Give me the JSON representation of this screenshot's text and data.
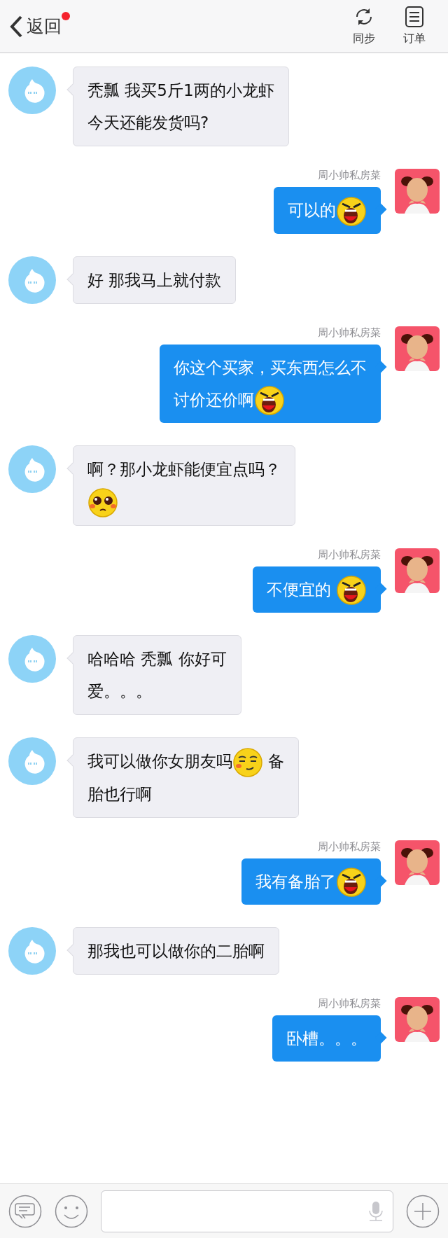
{
  "header": {
    "back_label": "返回",
    "notification_dot": true,
    "actions": [
      {
        "kind": "sync",
        "label": "同步"
      },
      {
        "kind": "orders",
        "label": "订单"
      }
    ]
  },
  "messages": [
    {
      "kind": "incoming",
      "parts": [
        {
          "kind": "text",
          "text": "秃瓢 我买5斤1两的小龙虾"
        },
        {
          "kind": "break"
        },
        {
          "kind": "text",
          "text": "今天还能发货吗?"
        }
      ]
    },
    {
      "kind": "outgoing",
      "sender": "周小帅私房菜",
      "parts": [
        {
          "kind": "text",
          "text": "可以的"
        },
        {
          "kind": "shouting_emoji"
        }
      ]
    },
    {
      "kind": "incoming",
      "parts": [
        {
          "kind": "text",
          "text": "好 那我马上就付款"
        }
      ]
    },
    {
      "kind": "outgoing",
      "sender": "周小帅私房菜",
      "parts": [
        {
          "kind": "text",
          "text": "你这个买家，买东西怎么不"
        },
        {
          "kind": "break"
        },
        {
          "kind": "text",
          "text": "讨价还价啊"
        },
        {
          "kind": "shouting_emoji"
        }
      ]
    },
    {
      "kind": "incoming",
      "parts": [
        {
          "kind": "text",
          "text": "啊？那小龙虾能便宜点吗？"
        },
        {
          "kind": "break"
        },
        {
          "kind": "pleading_emoji"
        }
      ]
    },
    {
      "kind": "outgoing",
      "sender": "周小帅私房菜",
      "parts": [
        {
          "kind": "text",
          "text": "不便宜的 "
        },
        {
          "kind": "shouting_emoji"
        }
      ]
    },
    {
      "kind": "incoming",
      "parts": [
        {
          "kind": "text",
          "text": "哈哈哈 秃瓢 你好可"
        },
        {
          "kind": "break"
        },
        {
          "kind": "text",
          "text": "爱。。。"
        }
      ]
    },
    {
      "kind": "incoming",
      "parts": [
        {
          "kind": "text",
          "text": "我可以做你女朋友吗"
        },
        {
          "kind": "smirking_emoji"
        },
        {
          "kind": "text",
          "text": " 备"
        },
        {
          "kind": "break"
        },
        {
          "kind": "text",
          "text": "胎也行啊"
        }
      ]
    },
    {
      "kind": "outgoing",
      "sender": "周小帅私房菜",
      "parts": [
        {
          "kind": "text",
          "text": "我有备胎了"
        },
        {
          "kind": "shouting_emoji"
        }
      ]
    },
    {
      "kind": "incoming",
      "parts": [
        {
          "kind": "text",
          "text": "那我也可以做你的二胎啊"
        }
      ]
    },
    {
      "kind": "outgoing",
      "sender": "周小帅私房菜",
      "parts": [
        {
          "kind": "text",
          "text": "卧槽。。。"
        }
      ]
    }
  ]
}
